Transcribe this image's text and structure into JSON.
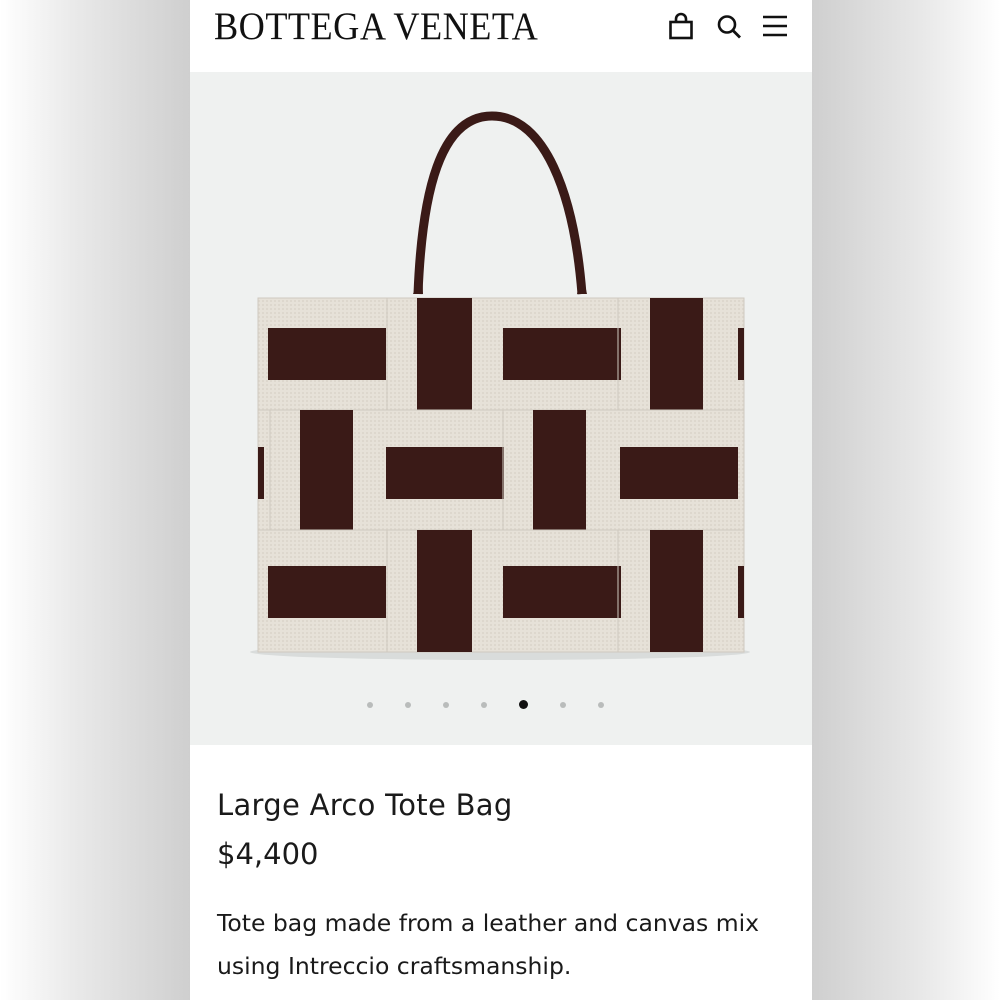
{
  "header": {
    "brand": "BOTTEGA VENETA",
    "icons": [
      "shopping-bag-icon",
      "search-icon",
      "menu-icon"
    ]
  },
  "gallery": {
    "image_subject": "tote-bag-image",
    "slide_count": 7,
    "active_slide": 5
  },
  "product": {
    "title": "Large Arco Tote Bag",
    "price": "$4,400",
    "description": "Tote bag made from a leather and canvas mix using Intreccio craftsmanship."
  },
  "colors": {
    "leather": "#3a1a17",
    "canvas": "#e6e1d8",
    "gallery_bg": "#eff1f0",
    "dot_inactive": "#b9bcbb",
    "dot_active": "#111111"
  }
}
